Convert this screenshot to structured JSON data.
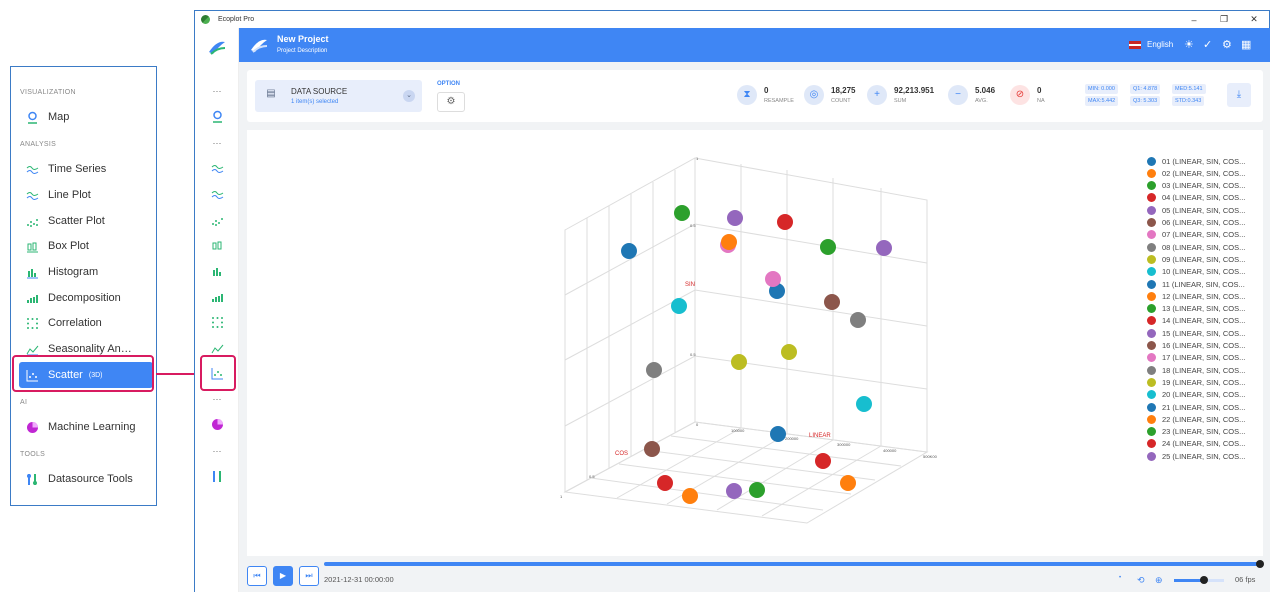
{
  "menu": {
    "sections": {
      "visualization": "VISUALIZATION",
      "analysis": "ANALYSIS",
      "ai": "AI",
      "tools": "TOOLS"
    },
    "items": [
      {
        "label": "Map",
        "icon": "map-pin-icon"
      },
      {
        "label": "Time Series",
        "icon": "wave-icon"
      },
      {
        "label": "Line Plot",
        "icon": "wave-icon"
      },
      {
        "label": "Scatter Plot",
        "icon": "scatter-icon"
      },
      {
        "label": "Box Plot",
        "icon": "box-plot-icon"
      },
      {
        "label": "Histogram",
        "icon": "histogram-icon"
      },
      {
        "label": "Decomposition",
        "icon": "bars-icon"
      },
      {
        "label": "Correlation",
        "icon": "dots-grid-icon"
      },
      {
        "label": "Seasonality An…",
        "icon": "seasonality-icon"
      },
      {
        "label": "Scatter",
        "tag": "(3D)",
        "icon": "scatter-3d-icon"
      },
      {
        "label": "Machine Learning",
        "icon": "pie-icon"
      },
      {
        "label": "Datasource Tools",
        "icon": "tools-icon"
      }
    ]
  },
  "window": {
    "title": "Ecoplot Pro",
    "controls": [
      "–",
      "❐",
      "✕"
    ]
  },
  "sidebar": {
    "dots": "···"
  },
  "header": {
    "project_title": "New Project",
    "project_desc": "Project Description",
    "language": "English",
    "icons": [
      "sun-icon",
      "check-circle-icon",
      "gear-icon",
      "grid-icon"
    ]
  },
  "toolbar": {
    "data_source_title": "DATA SOURCE",
    "data_source_sub": "1 item(s) selected",
    "option_label": "OPTION",
    "stats": [
      {
        "value": "0",
        "label": "RESAMPLE",
        "icon": "resample-icon"
      },
      {
        "value": "18,275",
        "label": "COUNT",
        "icon": "target-icon"
      },
      {
        "value": "92,213.951",
        "label": "SUM",
        "icon": "plus-circle-icon"
      },
      {
        "value": "5.046",
        "label": "AVG.",
        "icon": "minus-circle-icon"
      },
      {
        "value": "0",
        "label": "NA",
        "icon": "ban-icon"
      }
    ],
    "metrics": {
      "min": "MIN: 0.000",
      "q1": "Q1:  4.878",
      "med": "MED:5.141",
      "max": "MAX:5.442",
      "q3": "Q3:  5.303",
      "std": "STD:0.343"
    }
  },
  "chart": {
    "axis_labels": {
      "x": "LINEAR",
      "y": "SIN",
      "z": "COS"
    },
    "ticks": {
      "top": "1",
      "mid1": "0.5",
      "mid2": "0.5",
      "origin": "0",
      "bottom": "1",
      "left": "0.5",
      "x_end": "500K00",
      "x_t1": "100000",
      "x_t2": "200000",
      "x_t3": "300000",
      "x_t4": "400000"
    }
  },
  "chart_data": {
    "type": "scatter",
    "title": "",
    "xlabel": "LINEAR",
    "ylabel": "SIN",
    "zlabel": "COS",
    "series": [
      {
        "name": "01 (LINEAR, SIN, COS...",
        "color": "#1f77b4"
      },
      {
        "name": "02 (LINEAR, SIN, COS...",
        "color": "#ff7f0e"
      },
      {
        "name": "03 (LINEAR, SIN, COS...",
        "color": "#2ca02c"
      },
      {
        "name": "04 (LINEAR, SIN, COS...",
        "color": "#d62728"
      },
      {
        "name": "05 (LINEAR, SIN, COS...",
        "color": "#9467bd"
      },
      {
        "name": "06 (LINEAR, SIN, COS...",
        "color": "#8c564b"
      },
      {
        "name": "07 (LINEAR, SIN, COS...",
        "color": "#e377c2"
      },
      {
        "name": "08 (LINEAR, SIN, COS...",
        "color": "#7f7f7f"
      },
      {
        "name": "09 (LINEAR, SIN, COS...",
        "color": "#bcbd22"
      },
      {
        "name": "10 (LINEAR, SIN, COS...",
        "color": "#17becf"
      },
      {
        "name": "11 (LINEAR, SIN, COS...",
        "color": "#1f77b4"
      },
      {
        "name": "12 (LINEAR, SIN, COS...",
        "color": "#ff7f0e"
      },
      {
        "name": "13 (LINEAR, SIN, COS...",
        "color": "#2ca02c"
      },
      {
        "name": "14 (LINEAR, SIN, COS...",
        "color": "#d62728"
      },
      {
        "name": "15 (LINEAR, SIN, COS...",
        "color": "#9467bd"
      },
      {
        "name": "16 (LINEAR, SIN, COS...",
        "color": "#8c564b"
      },
      {
        "name": "17 (LINEAR, SIN, COS...",
        "color": "#e377c2"
      },
      {
        "name": "18 (LINEAR, SIN, COS...",
        "color": "#7f7f7f"
      },
      {
        "name": "19 (LINEAR, SIN, COS...",
        "color": "#bcbd22"
      },
      {
        "name": "20 (LINEAR, SIN, COS...",
        "color": "#17becf"
      },
      {
        "name": "21 (LINEAR, SIN, COS...",
        "color": "#1f77b4"
      },
      {
        "name": "22 (LINEAR, SIN, COS...",
        "color": "#ff7f0e"
      },
      {
        "name": "23 (LINEAR, SIN, COS...",
        "color": "#2ca02c"
      },
      {
        "name": "24 (LINEAR, SIN, COS...",
        "color": "#d62728"
      },
      {
        "name": "25 (LINEAR, SIN, COS...",
        "color": "#9467bd"
      }
    ]
  },
  "playback": {
    "timestamp": "2021-12-31 00:00:00",
    "fps": "06 fps",
    "progress": 1.0,
    "speed": 0.6
  }
}
